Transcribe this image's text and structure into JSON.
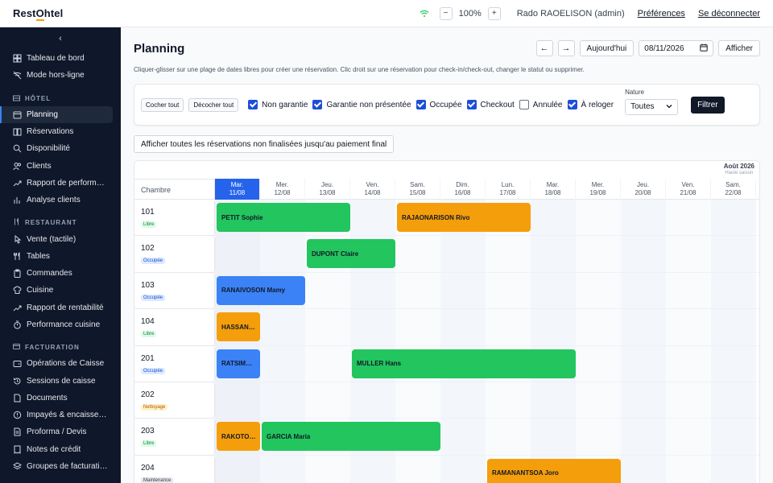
{
  "brand": {
    "part1": "Rest",
    "part2": "O",
    "part3": "htel"
  },
  "topbar": {
    "zoom_minus": "−",
    "zoom_value": "100%",
    "zoom_plus": "+",
    "user": "Rado RAOELISON (admin)",
    "preferences": "Préférences",
    "logout": "Se déconnecter"
  },
  "sidebar": {
    "collapse_glyph": "‹",
    "top_items": [
      {
        "label": "Tableau de bord",
        "icon": "grid-icon"
      },
      {
        "label": "Mode hors-ligne",
        "icon": "wifi-off-icon"
      }
    ],
    "sections": [
      {
        "title": "HÔTEL",
        "items": [
          {
            "label": "Planning",
            "icon": "calendar-icon",
            "active": true
          },
          {
            "label": "Réservations",
            "icon": "book-icon"
          },
          {
            "label": "Disponibilité",
            "icon": "search-icon"
          },
          {
            "label": "Clients",
            "icon": "users-icon"
          },
          {
            "label": "Rapport de performance",
            "icon": "trend-icon"
          },
          {
            "label": "Analyse clients",
            "icon": "chart-icon"
          }
        ]
      },
      {
        "title": "RESTAURANT",
        "items": [
          {
            "label": "Vente (tactile)",
            "icon": "pointer-icon"
          },
          {
            "label": "Tables",
            "icon": "utensils-icon"
          },
          {
            "label": "Commandes",
            "icon": "clipboard-icon"
          },
          {
            "label": "Cuisine",
            "icon": "chef-icon"
          },
          {
            "label": "Rapport de rentabilité",
            "icon": "trend-icon"
          },
          {
            "label": "Performance cuisine",
            "icon": "timer-icon"
          }
        ]
      },
      {
        "title": "FACTURATION",
        "items": [
          {
            "label": "Opérations de Caisse",
            "icon": "wallet-icon"
          },
          {
            "label": "Sessions de caisse",
            "icon": "history-icon"
          },
          {
            "label": "Documents",
            "icon": "file-icon"
          },
          {
            "label": "Impayés & encaissem…",
            "icon": "alert-icon"
          },
          {
            "label": "Proforma / Devis",
            "icon": "doc-icon"
          },
          {
            "label": "Notes de crédit",
            "icon": "receipt-icon"
          },
          {
            "label": "Groupes de facturation",
            "icon": "layers-icon"
          }
        ]
      }
    ]
  },
  "page": {
    "title": "Planning",
    "prev": "←",
    "next": "→",
    "today": "Aujourd'hui",
    "date": "08/11/2026",
    "show": "Afficher",
    "help": "Cliquer-glisser sur une plage de dates libres pour créer une réservation. Clic droit sur une réservation pour check-in/check-out, changer le statut ou supprimer."
  },
  "filters": {
    "check_all": "Cocher tout",
    "uncheck_all": "Décocher tout",
    "options": [
      {
        "label": "Non garantie",
        "checked": true
      },
      {
        "label": "Garantie non présentée",
        "checked": true
      },
      {
        "label": "Occupée",
        "checked": true
      },
      {
        "label": "Checkout",
        "checked": true
      },
      {
        "label": "Annulée",
        "checked": false
      },
      {
        "label": "À reloger",
        "checked": true
      }
    ],
    "nature_label": "Nature",
    "nature_value": "Toutes",
    "filter_button": "Filtrer"
  },
  "show_all_button": "Afficher toutes les réservations non finalisées jusqu'au paiement final",
  "grid": {
    "month": "Août 2026",
    "season": "Haute saison",
    "room_header": "Chambre",
    "days": [
      {
        "dow": "Mar.",
        "date": "11/08",
        "today": true
      },
      {
        "dow": "Mer.",
        "date": "12/08"
      },
      {
        "dow": "Jeu.",
        "date": "13/08"
      },
      {
        "dow": "Ven.",
        "date": "14/08"
      },
      {
        "dow": "Sam.",
        "date": "15/08"
      },
      {
        "dow": "Dim.",
        "date": "16/08"
      },
      {
        "dow": "Lun.",
        "date": "17/08"
      },
      {
        "dow": "Mar.",
        "date": "18/08"
      },
      {
        "dow": "Mer.",
        "date": "19/08"
      },
      {
        "dow": "Jeu.",
        "date": "20/08"
      },
      {
        "dow": "Ven.",
        "date": "21/08"
      },
      {
        "dow": "Sam.",
        "date": "22/08"
      }
    ],
    "rooms": [
      {
        "number": "101",
        "status": "Libre",
        "status_kind": "free",
        "bookings": [
          {
            "guest": "PETIT Sophie",
            "start": 0,
            "span": 3,
            "color": "green"
          },
          {
            "guest": "RAJAONARISON Rivo",
            "start": 4,
            "span": 3,
            "color": "orange"
          }
        ]
      },
      {
        "number": "102",
        "status": "Occupée",
        "status_kind": "occupied",
        "bookings": [
          {
            "guest": "DUPONT Claire",
            "start": 2,
            "span": 2,
            "color": "green"
          }
        ]
      },
      {
        "number": "103",
        "status": "Occupée",
        "status_kind": "occupied",
        "bookings": [
          {
            "guest": "RANAIVOSON Mamy",
            "start": 0,
            "span": 2,
            "color": "blue"
          }
        ]
      },
      {
        "number": "104",
        "status": "Libre",
        "status_kind": "free",
        "bookings": [
          {
            "guest": "HASSAN…",
            "start": 0,
            "span": 1,
            "color": "orange"
          }
        ]
      },
      {
        "number": "201",
        "status": "Occupée",
        "status_kind": "occupied",
        "bookings": [
          {
            "guest": "RATSIM…",
            "start": 0,
            "span": 1,
            "color": "blue"
          },
          {
            "guest": "MULLER Hans",
            "start": 3,
            "span": 5,
            "color": "green"
          }
        ]
      },
      {
        "number": "202",
        "status": "Nettoyage",
        "status_kind": "cleaning",
        "bookings": []
      },
      {
        "number": "203",
        "status": "Libre",
        "status_kind": "free",
        "bookings": [
          {
            "guest": "RAKOTO…",
            "start": 0,
            "span": 1,
            "color": "orange"
          },
          {
            "guest": "GARCIA Maria",
            "start": 1,
            "span": 4,
            "color": "green"
          }
        ]
      },
      {
        "number": "204",
        "status": "Maintenance",
        "status_kind": "maintenance",
        "bookings": [
          {
            "guest": "RAMANANTSOA Joro",
            "start": 6,
            "span": 3,
            "color": "orange"
          }
        ]
      }
    ]
  },
  "colors": {
    "green": "#22c55e",
    "orange": "#f59e0b",
    "blue": "#3b82f6",
    "badge_free_bg": "#dcfce7",
    "badge_free_fg": "#15803d",
    "badge_occ_bg": "#dbeafe",
    "badge_occ_fg": "#1d4ed8",
    "badge_clean_bg": "#fef3c7",
    "badge_clean_fg": "#b45309",
    "badge_maint_bg": "#e5e7eb",
    "badge_maint_fg": "#374151"
  }
}
